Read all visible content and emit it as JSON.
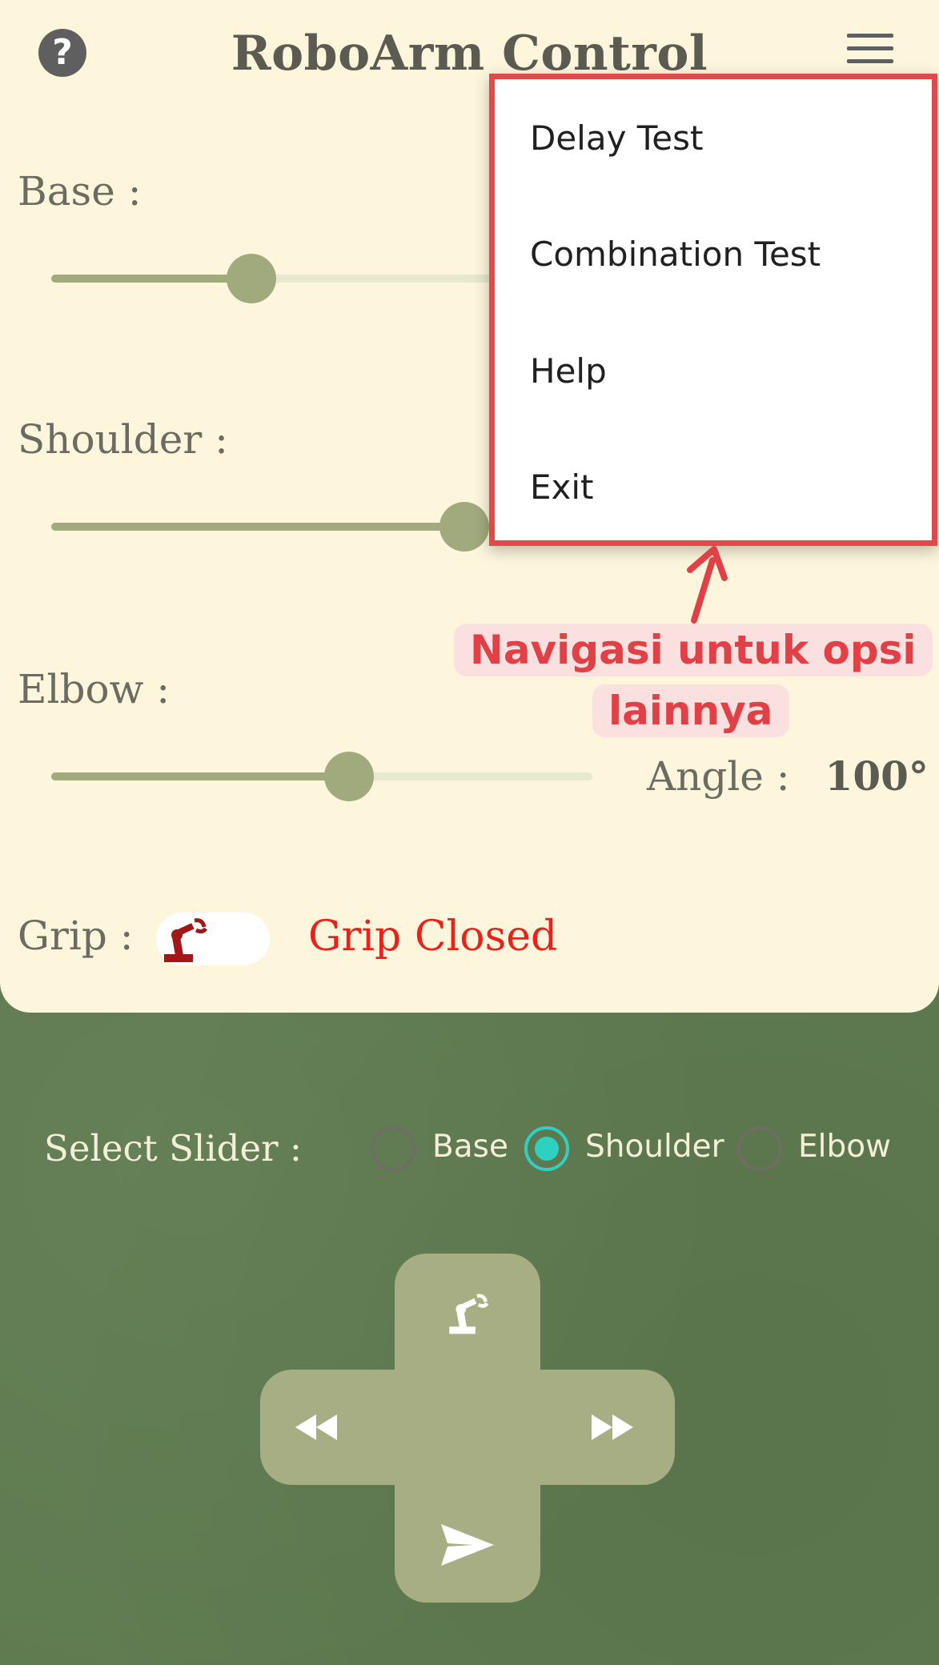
{
  "header": {
    "title": "RoboArm Control",
    "help_icon": "question-circle-icon",
    "menu_icon": "hamburger-menu-icon"
  },
  "sliders": [
    {
      "label": "Base  :",
      "value_fraction": 0.37
    },
    {
      "label": "Shoulder  :",
      "value_fraction": 0.77
    },
    {
      "label": "Elbow  :",
      "value_fraction": 0.55,
      "angle_label": "Angle  :",
      "angle_value": "100°"
    }
  ],
  "grip": {
    "label": "Grip  :",
    "status": "Grip Closed",
    "icon": "robot-arm-icon",
    "status_color": "#e8231b"
  },
  "select_slider": {
    "label": "Select Slider    :",
    "options": [
      {
        "label": "Base",
        "selected": false
      },
      {
        "label": "Shoulder",
        "selected": true
      },
      {
        "label": "Elbow",
        "selected": false
      }
    ]
  },
  "dpad": {
    "up_icon": "robot-arm-icon",
    "left_icon": "rewind-icon",
    "right_icon": "fast-forward-icon",
    "down_icon": "send-icon"
  },
  "menu": {
    "items": [
      "Delay Test",
      "Combination Test",
      "Help",
      "Exit"
    ]
  },
  "annotation": {
    "line1": "Navigasi untuk opsi",
    "line2": "lainnya",
    "color": "#e04046"
  },
  "colors": {
    "panel": "#fdf6dc",
    "background": "#5f7b50",
    "slider": "#a1aa7d",
    "accent": "#2ed1c0"
  }
}
